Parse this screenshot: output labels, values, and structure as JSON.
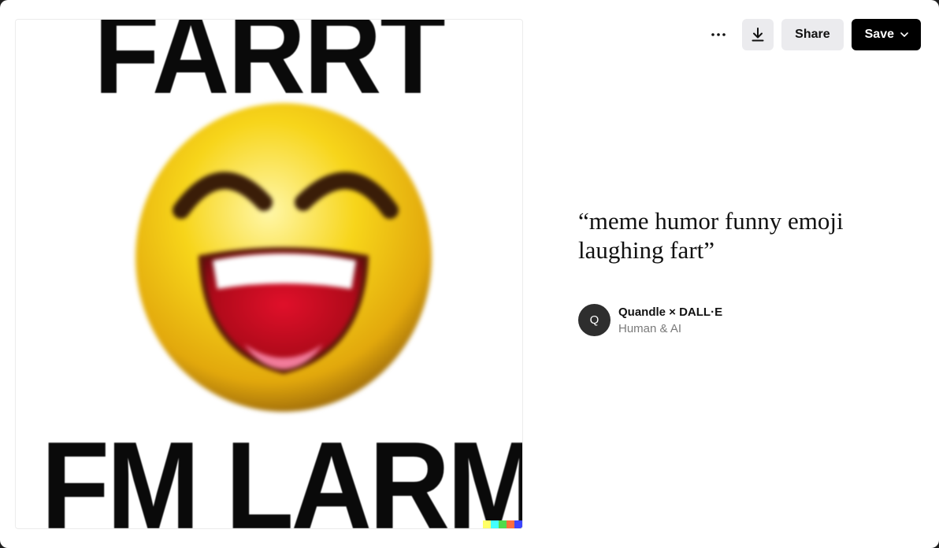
{
  "image": {
    "meme_top_text": "FARRT",
    "meme_bottom_text": "FM LARM",
    "signature_colors": [
      "#ffff66",
      "#42ffff",
      "#51da4c",
      "#ff6e3c",
      "#3c46ff"
    ]
  },
  "toolbar": {
    "more_icon": "ellipsis-icon",
    "download_icon": "download-icon",
    "share_label": "Share",
    "save_label": "Save",
    "save_icon": "chevron-down-icon"
  },
  "prompt": {
    "text": "“meme humor funny emoji laughing fart”"
  },
  "author": {
    "avatar_initial": "Q",
    "name": "Quandle × DALL·E",
    "subtitle": "Human & AI"
  },
  "colors": {
    "save_button_bg": "#000000",
    "secondary_button_bg": "#ebebee",
    "avatar_bg": "#2e2e2e",
    "emoji_yellow": "#f7d51a"
  }
}
